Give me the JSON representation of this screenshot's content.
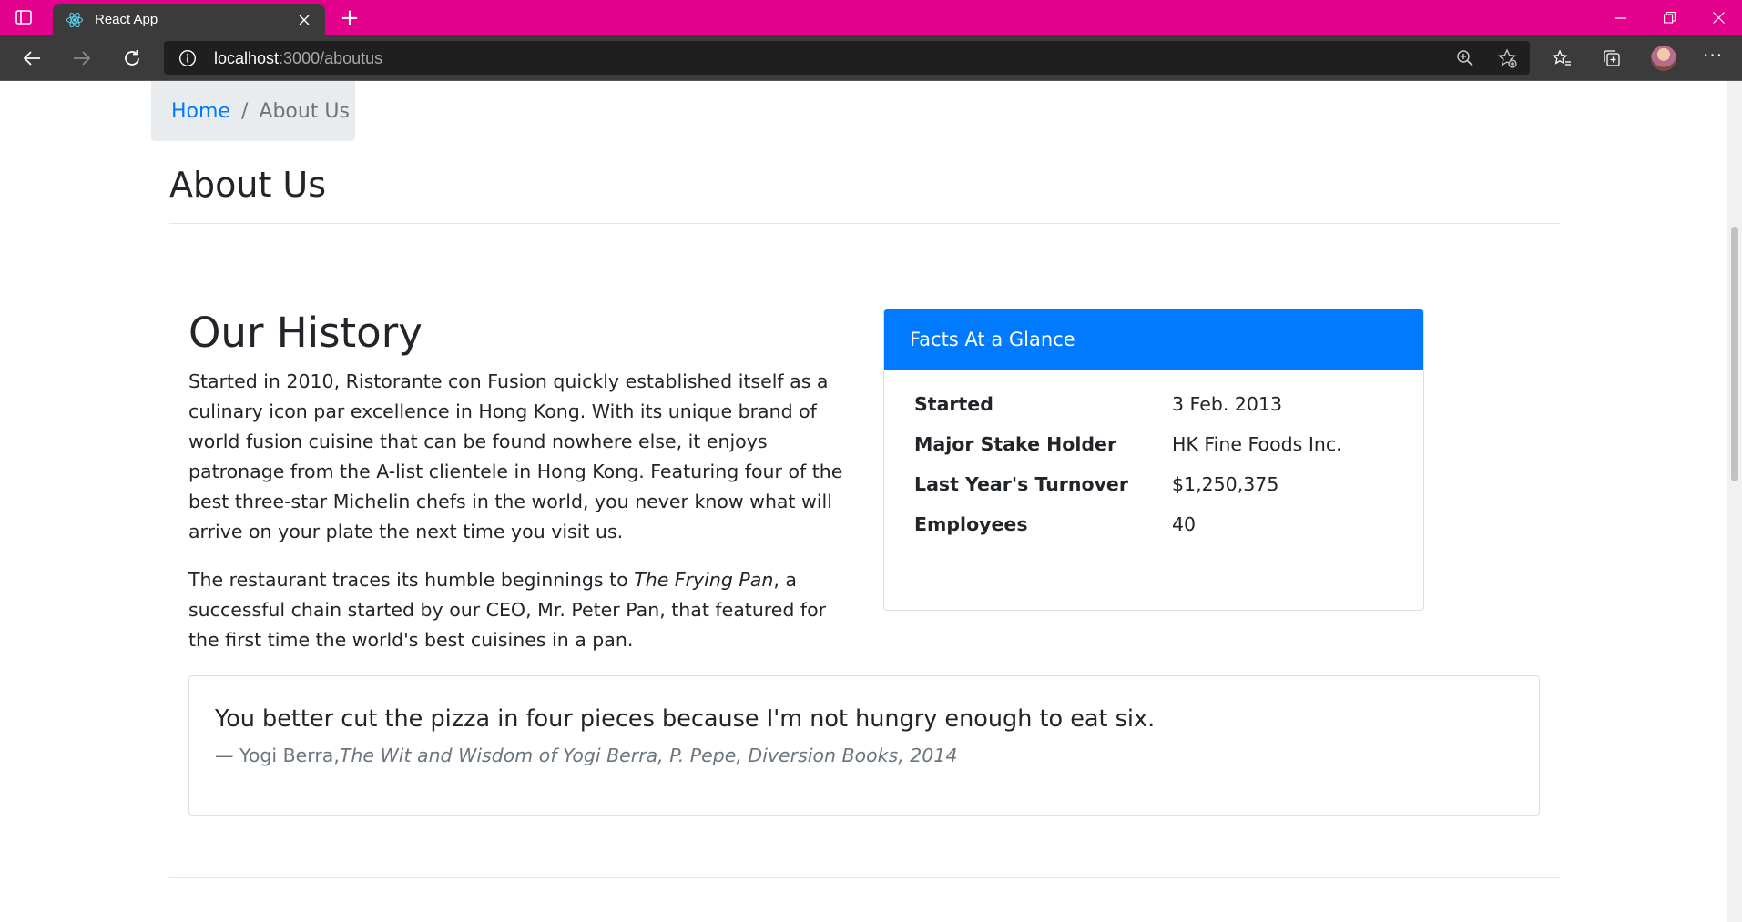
{
  "browser": {
    "tab": {
      "title": "React App"
    },
    "address": {
      "host": "localhost",
      "path": ":3000/aboutus"
    },
    "window_controls": {
      "minimize": "—",
      "restore": "❐",
      "close": "✕"
    },
    "new_tab": "+",
    "more": "···"
  },
  "breadcrumb": {
    "home": "Home",
    "separator": "/",
    "current": "About Us"
  },
  "page": {
    "title": "About Us"
  },
  "history": {
    "title": "Our History",
    "paragraph1": "Started in 2010, Ristorante con Fusion quickly established itself as a culinary icon par excellence in Hong Kong. With its unique brand of world fusion cuisine that can be found nowhere else, it enjoys patronage from the A-list clientele in Hong Kong. Featuring four of the best three-star Michelin chefs in the world, you never know what will arrive on your plate the next time you visit us.",
    "paragraph2_before": "The restaurant traces its humble beginnings to ",
    "paragraph2_em": "The Frying Pan",
    "paragraph2_after": ", a successful chain started by our CEO, Mr. Peter Pan, that featured for the first time the world's best cuisines in a pan."
  },
  "facts": {
    "header": "Facts At a Glance",
    "items": [
      {
        "label": "Started",
        "value": "3 Feb. 2013"
      },
      {
        "label": "Major Stake Holder",
        "value": "HK Fine Foods Inc."
      },
      {
        "label": "Last Year's Turnover",
        "value": "$1,250,375"
      },
      {
        "label": "Employees",
        "value": "40"
      }
    ]
  },
  "quote": {
    "text": "You better cut the pizza in four pieces because I'm not hungry enough to eat six.",
    "author": "— Yogi Berra,",
    "source": "The Wit and Wisdom of Yogi Berra, P. Pepe, Diversion Books, 2014"
  },
  "colors": {
    "titlebar": "#e3008c",
    "toolbar": "#3b3b3b",
    "primary": "#007bff",
    "breadcrumb_bg": "#e9ecef",
    "muted": "#6c757d"
  }
}
